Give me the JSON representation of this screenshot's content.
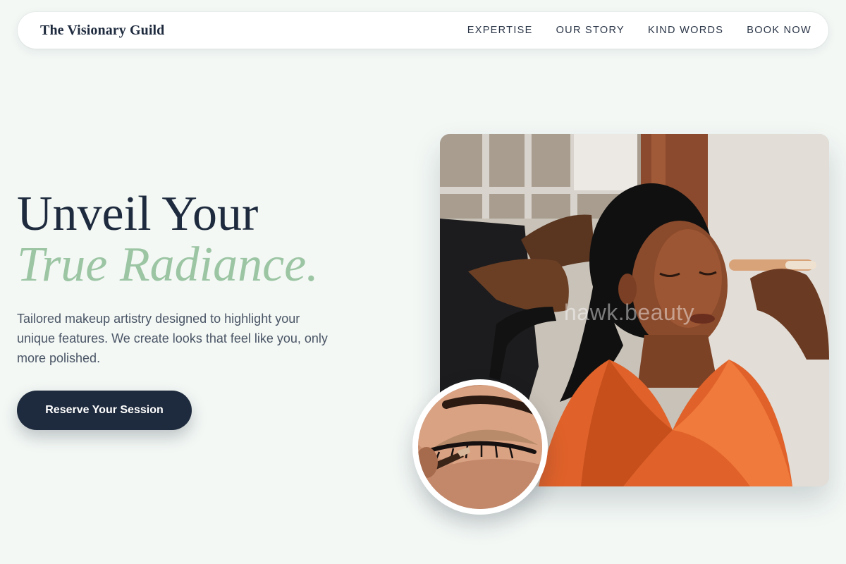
{
  "nav": {
    "brand": "The Visionary Guild",
    "links": [
      "EXPERTISE",
      "OUR STORY",
      "KIND WORDS",
      "BOOK NOW"
    ]
  },
  "hero": {
    "title_line1": "Unveil Your",
    "title_line2": "True Radiance.",
    "subtitle": "Tailored makeup artistry designed to highlight your unique features. We create looks that feel like you, only more polished.",
    "cta_label": "Reserve Your Session"
  },
  "images": {
    "main_watermark": "hawk.beauty"
  },
  "colors": {
    "background": "#f3f8f5",
    "navy": "#1e2a3d",
    "sage_accent": "#9cc5a3",
    "body_text": "#4a5565"
  }
}
